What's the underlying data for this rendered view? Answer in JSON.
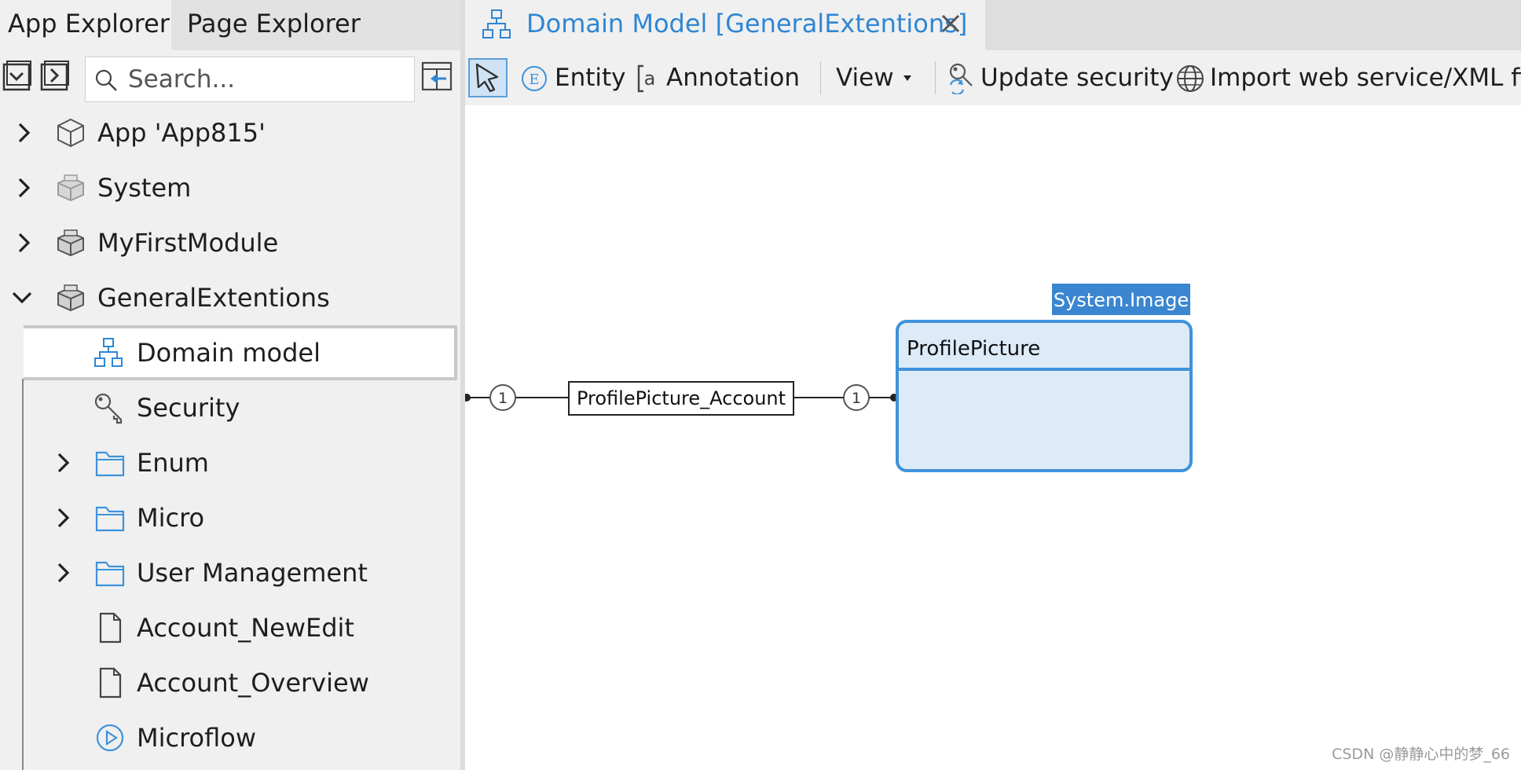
{
  "left_pane": {
    "tabs": [
      {
        "label": "App Explorer",
        "active": true
      },
      {
        "label": "Page Explorer",
        "active": false
      }
    ],
    "search": {
      "placeholder": "Search..."
    },
    "tree": [
      {
        "label": "App 'App815'",
        "icon": "cube-outline-icon",
        "expander": "collapsed"
      },
      {
        "label": "System",
        "icon": "module-gray-icon",
        "expander": "collapsed"
      },
      {
        "label": "MyFirstModule",
        "icon": "module-icon",
        "expander": "collapsed"
      },
      {
        "label": "GeneralExtentions",
        "icon": "module-icon",
        "expander": "expanded"
      },
      {
        "label": "Domain model",
        "icon": "domain-model-icon",
        "selected": true
      },
      {
        "label": "Security",
        "icon": "key-icon"
      },
      {
        "label": "Enum",
        "icon": "folder-icon",
        "expander": "collapsed"
      },
      {
        "label": "Micro",
        "icon": "folder-icon",
        "expander": "collapsed"
      },
      {
        "label": "User Management",
        "icon": "folder-icon",
        "expander": "collapsed"
      },
      {
        "label": "Account_NewEdit",
        "icon": "page-icon"
      },
      {
        "label": "Account_Overview",
        "icon": "page-icon"
      },
      {
        "label": "Microflow",
        "icon": "microflow-icon"
      }
    ]
  },
  "editor": {
    "tab": {
      "title": "Domain Model [GeneralExtentions]",
      "icon": "domain-model-icon"
    },
    "toolbar": {
      "entity": "Entity",
      "annotation": "Annotation",
      "view": "View",
      "update_security": "Update security",
      "import": "Import web service/XML file"
    },
    "diagram": {
      "association": {
        "name": "ProfilePicture_Account",
        "left_multiplicity": "1",
        "right_multiplicity": "1"
      },
      "entity": {
        "name": "ProfilePicture",
        "generalization": "System.Image"
      }
    }
  },
  "watermark": "CSDN @静静心中的梦_66",
  "colors": {
    "accent": "#2f86d4",
    "entity_fill": "#dcebf7",
    "entity_border": "#3e92dc",
    "generalization_bg": "#3a86d0"
  }
}
